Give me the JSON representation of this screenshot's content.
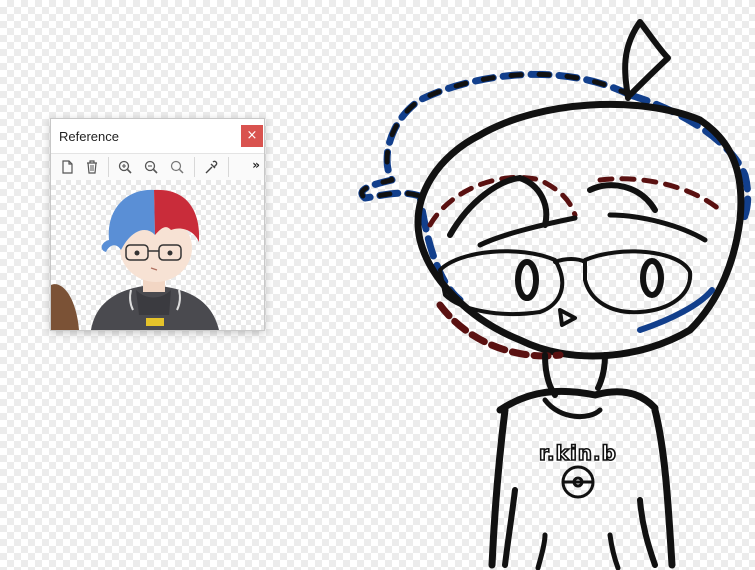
{
  "reference_panel": {
    "title": "Reference",
    "close_glyph": "×",
    "more_glyph": "»",
    "close_color": "#d9534f",
    "toolbar": [
      {
        "name": "new-icon"
      },
      {
        "name": "delete-icon"
      },
      {
        "name": "zoom-in-icon"
      },
      {
        "name": "zoom-out-icon"
      },
      {
        "name": "zoom-reset-icon"
      },
      {
        "name": "eyedropper-icon"
      }
    ]
  },
  "sketch": {
    "shirt_text": "r.kin.b",
    "stroke_black": "#111111",
    "stroke_blue": "#123f8c",
    "stroke_red": "#5a1111"
  }
}
